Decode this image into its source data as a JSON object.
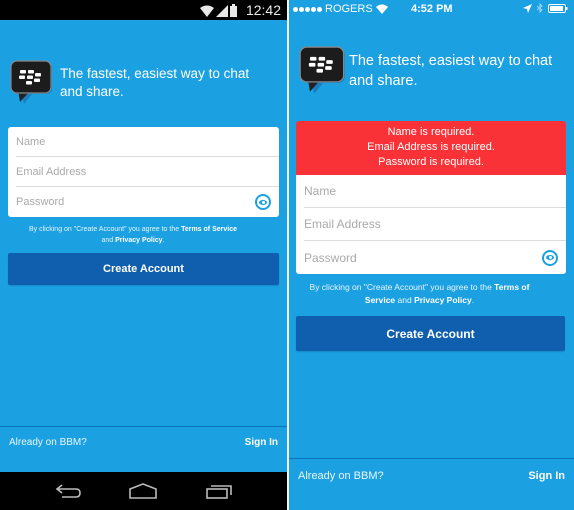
{
  "android": {
    "status_bar": {
      "time": "12:42",
      "icons": [
        "wifi-icon",
        "signal-icon",
        "battery-icon"
      ]
    },
    "header": {
      "logo": "bbm-logo",
      "tagline": "The fastest, easiest way to chat and share."
    },
    "form": {
      "name": {
        "placeholder": "Name",
        "value": ""
      },
      "email": {
        "placeholder": "Email Address",
        "value": ""
      },
      "password": {
        "placeholder": "Password",
        "value": "",
        "toggle_icon": "eye-icon"
      }
    },
    "terms": {
      "prefix": "By clicking on \"Create Account\" you agree to the ",
      "terms_link": "Terms of Service",
      "middle": " and ",
      "privacy_link": "Privacy Policy",
      "suffix": "."
    },
    "create_button": "Create Account",
    "footer": {
      "prompt": "Already on BBM?",
      "signin": "Sign In"
    },
    "nav_bar": {
      "buttons": [
        "back-icon",
        "home-icon",
        "recent-apps-icon"
      ]
    }
  },
  "ios": {
    "status_bar": {
      "carrier": "ROGERS",
      "signal_dots": 5,
      "time": "4:52 PM",
      "icons": [
        "wifi-icon",
        "location-icon",
        "bluetooth-icon",
        "battery-icon"
      ]
    },
    "header": {
      "logo": "bbm-logo",
      "tagline": "The fastest, easiest way to chat and share."
    },
    "errors": [
      "Name is required.",
      "Email Address is required.",
      "Password is required."
    ],
    "error_color": "#f83237",
    "form": {
      "name": {
        "placeholder": "Name",
        "value": ""
      },
      "email": {
        "placeholder": "Email Address",
        "value": ""
      },
      "password": {
        "placeholder": "Password",
        "value": "",
        "toggle_icon": "eye-icon"
      }
    },
    "terms": {
      "prefix": "By clicking on \"Create Account\" you agree to the ",
      "terms_link": "Terms of Service",
      "middle": " and ",
      "privacy_link": "Privacy Policy",
      "suffix": "."
    },
    "create_button": "Create Account",
    "footer": {
      "prompt": "Already on BBM?",
      "signin": "Sign In"
    }
  },
  "colors": {
    "background": "#1ba1e2",
    "button": "#0f5fae",
    "error": "#f83237"
  }
}
